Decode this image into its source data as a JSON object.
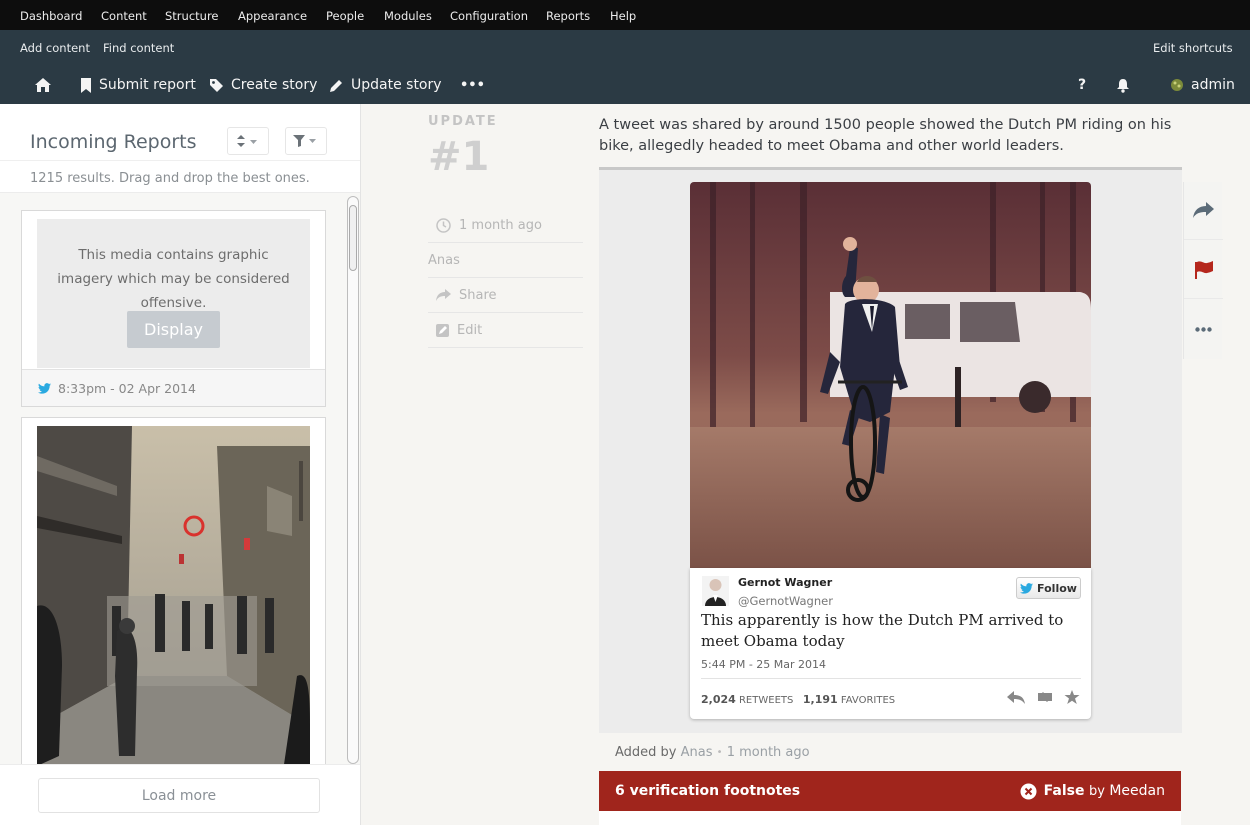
{
  "admin_menu": [
    "Dashboard",
    "Content",
    "Structure",
    "Appearance",
    "People",
    "Modules",
    "Configuration",
    "Reports",
    "Help"
  ],
  "shortcuts": {
    "items": [
      "Add content",
      "Find content"
    ],
    "edit": "Edit shortcuts"
  },
  "toolbar": {
    "submit_report": "Submit report",
    "create_story": "Create story",
    "update_story": "Update story",
    "more": "•••",
    "help": "?",
    "user": "admin"
  },
  "sidebar": {
    "title": "Incoming Reports",
    "results": "1215 results. Drag and drop the best ones.",
    "card1": {
      "warning": "This media contains graphic imagery which may be considered offensive.",
      "display_button": "Display",
      "timestamp": "8:33pm - 02 Apr 2014"
    },
    "load_more": "Load more"
  },
  "update": {
    "label": "UPDATE",
    "number": "#1",
    "time": "1 month ago",
    "author": "Anas",
    "share": "Share",
    "edit": "Edit"
  },
  "story": {
    "text": "A tweet was shared by around 1500 people showed the Dutch PM riding on his bike, allegedly headed to meet Obama and other world leaders."
  },
  "tweet": {
    "name": "Gernot Wagner",
    "handle": "@GernotWagner",
    "follow": "Follow",
    "text": "This apparently is how the Dutch PM arrived to meet Obama today",
    "time": "5:44 PM - 25 Mar 2014",
    "retweets": "2,024",
    "retweets_label": "RETWEETS",
    "favorites": "1,191",
    "favorites_label": "FAVORITES"
  },
  "added_by": {
    "prefix": "Added by",
    "user": "Anas",
    "sep": "•",
    "time": "1 month ago"
  },
  "verification": {
    "footnotes": "6 verification footnotes",
    "status": "False",
    "by": "by",
    "source": "Meedan"
  },
  "colors": {
    "admin_bar": "#0d0d0d",
    "toolbar": "#2b3a44",
    "false_banner": "#a0251c",
    "flag": "#b5271d",
    "twitter": "#2aa9e0"
  }
}
